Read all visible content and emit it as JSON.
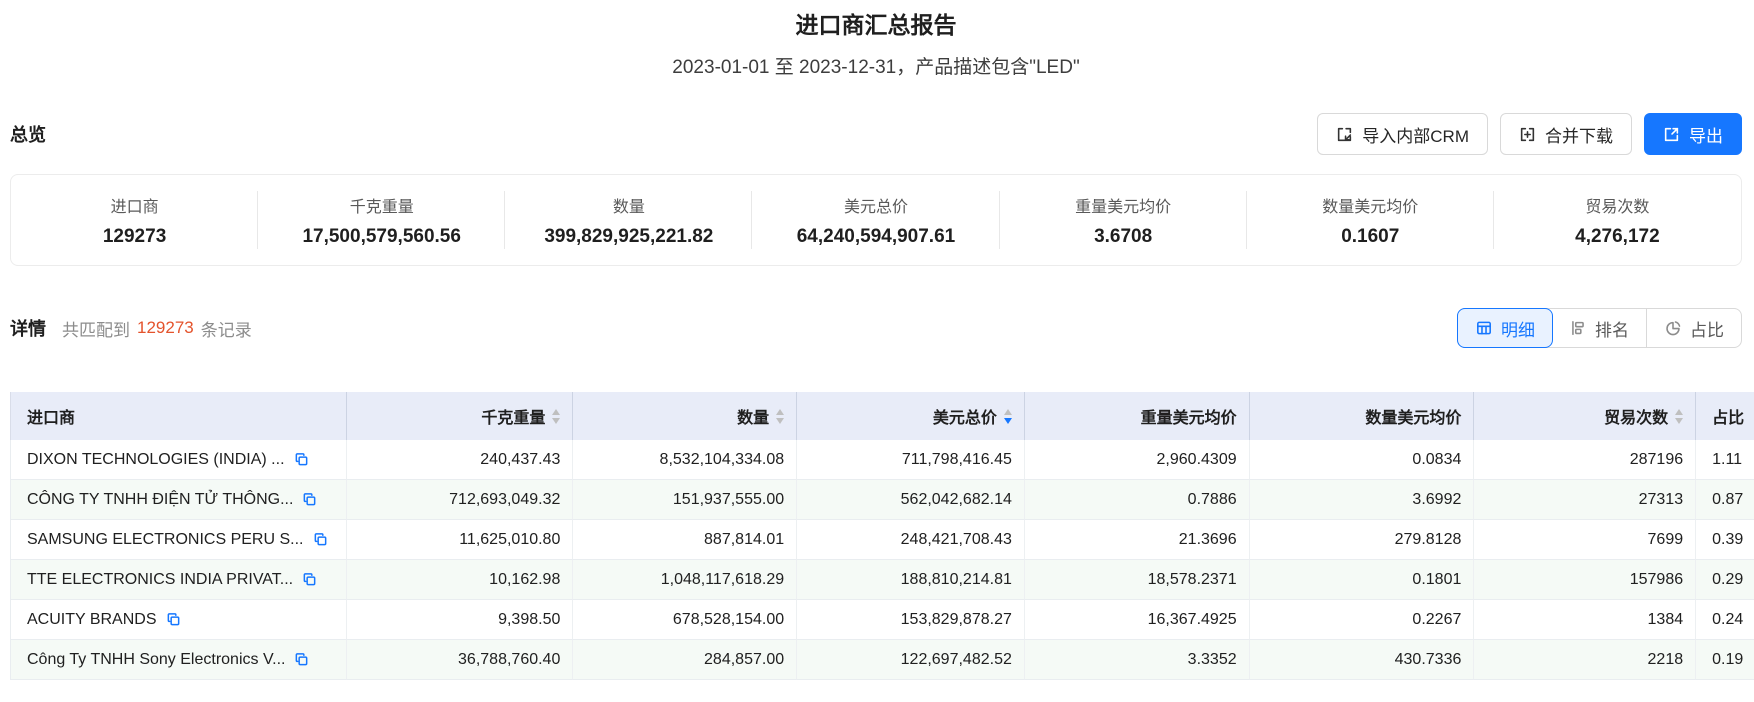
{
  "header": {
    "title": "进口商汇总报告",
    "subtitle": "2023-01-01 至 2023-12-31，产品描述包含\"LED\""
  },
  "toolbar": {
    "section_title": "总览",
    "buttons": [
      {
        "name": "import-crm-button",
        "icon": "import-icon",
        "label": "导入内部CRM",
        "primary": false
      },
      {
        "name": "merge-download-button",
        "icon": "merge-download-icon",
        "label": "合并下载",
        "primary": false
      },
      {
        "name": "export-button",
        "icon": "export-icon",
        "label": "导出",
        "primary": true
      }
    ]
  },
  "overview": {
    "stats": [
      {
        "label": "进口商",
        "value": "129273"
      },
      {
        "label": "千克重量",
        "value": "17,500,579,560.56"
      },
      {
        "label": "数量",
        "value": "399,829,925,221.82"
      },
      {
        "label": "美元总价",
        "value": "64,240,594,907.61"
      },
      {
        "label": "重量美元均价",
        "value": "3.6708"
      },
      {
        "label": "数量美元均价",
        "value": "0.1607"
      },
      {
        "label": "贸易次数",
        "value": "4,276,172"
      }
    ]
  },
  "detail": {
    "section_title": "详情",
    "match_prefix": "共匹配到",
    "match_count": "129273",
    "match_suffix": "条记录",
    "tabs": [
      {
        "name": "tab-detail",
        "icon": "table-icon",
        "label": "明细",
        "active": true
      },
      {
        "name": "tab-ranking",
        "icon": "ranking-icon",
        "label": "排名",
        "active": false
      },
      {
        "name": "tab-proportion",
        "icon": "pie-icon",
        "label": "占比",
        "active": false
      }
    ]
  },
  "table": {
    "columns": [
      {
        "key": "importer",
        "label": "进口商",
        "sortable": false,
        "align": "left"
      },
      {
        "key": "weight-kg",
        "label": "千克重量",
        "sortable": true,
        "sort": null,
        "align": "right"
      },
      {
        "key": "quantity",
        "label": "数量",
        "sortable": true,
        "sort": null,
        "align": "right"
      },
      {
        "key": "total-usd",
        "label": "美元总价",
        "sortable": true,
        "sort": "desc",
        "align": "right"
      },
      {
        "key": "usd-per-weight",
        "label": "重量美元均价",
        "sortable": false,
        "align": "right"
      },
      {
        "key": "usd-per-qty",
        "label": "数量美元均价",
        "sortable": false,
        "align": "right"
      },
      {
        "key": "trade-count",
        "label": "贸易次数",
        "sortable": true,
        "sort": null,
        "align": "right"
      },
      {
        "key": "share",
        "label": "占比",
        "sortable": false,
        "align": "left"
      }
    ],
    "rows": [
      {
        "name": "DIXON TECHNOLOGIES (INDIA) ...",
        "values": [
          "240,437.43",
          "8,532,104,334.08",
          "711,798,416.45",
          "2,960.4309",
          "0.0834",
          "287196",
          "1.11"
        ]
      },
      {
        "name": "CÔNG TY TNHH ĐIỆN TỬ THÔNG...",
        "values": [
          "712,693,049.32",
          "151,937,555.00",
          "562,042,682.14",
          "0.7886",
          "3.6992",
          "27313",
          "0.87"
        ]
      },
      {
        "name": "SAMSUNG ELECTRONICS PERU S...",
        "values": [
          "11,625,010.80",
          "887,814.01",
          "248,421,708.43",
          "21.3696",
          "279.8128",
          "7699",
          "0.39"
        ]
      },
      {
        "name": "TTE ELECTRONICS INDIA PRIVAT...",
        "values": [
          "10,162.98",
          "1,048,117,618.29",
          "188,810,214.81",
          "18,578.2371",
          "0.1801",
          "157986",
          "0.29"
        ]
      },
      {
        "name": "ACUITY BRANDS",
        "values": [
          "9,398.50",
          "678,528,154.00",
          "153,829,878.27",
          "16,367.4925",
          "0.2267",
          "1384",
          "0.24"
        ]
      },
      {
        "name": "Công Ty TNHH Sony Electronics V...",
        "values": [
          "36,788,760.40",
          "284,857.00",
          "122,697,482.52",
          "3.3352",
          "430.7336",
          "2218",
          "0.19"
        ]
      }
    ]
  },
  "icons": {
    "row_action": "copy-icon",
    "sort": [
      "sort-asc-icon",
      "sort-desc-icon"
    ]
  },
  "colors": {
    "accent": "#1677ff",
    "count_highlight": "#e4532c",
    "table_header_bg": "#e8ecf8",
    "row_alt_bg": "#f5faf6"
  }
}
